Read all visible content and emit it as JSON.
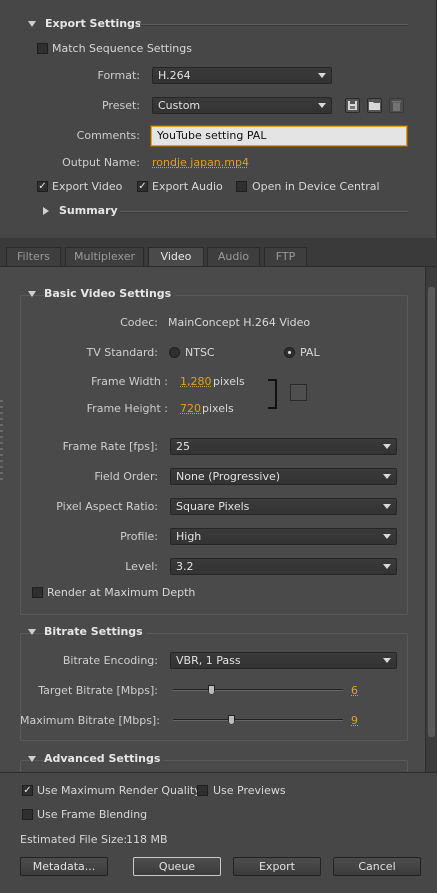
{
  "export_settings": {
    "title": "Export Settings",
    "match_sequence_label": "Match Sequence Settings",
    "match_sequence_checked": false,
    "format_label": "Format:",
    "format_value": "H.264",
    "preset_label": "Preset:",
    "preset_value": "Custom",
    "comments_label": "Comments:",
    "comments_value": "YouTube setting PAL",
    "output_name_label": "Output Name:",
    "output_name_value": "rondje japan.mp4",
    "export_video_label": "Export Video",
    "export_video_checked": true,
    "export_audio_label": "Export Audio",
    "export_audio_checked": true,
    "device_central_label": "Open in Device Central",
    "device_central_checked": false,
    "summary_label": "Summary"
  },
  "tabs": [
    "Filters",
    "Multiplexer",
    "Video",
    "Audio",
    "FTP"
  ],
  "active_tab": "Video",
  "basic_video": {
    "title": "Basic Video Settings",
    "codec_label": "Codec:",
    "codec_value": "MainConcept H.264 Video",
    "tv_standard_label": "TV Standard:",
    "ntsc_label": "NTSC",
    "pal_label": "PAL",
    "tv_standard_selected": "PAL",
    "frame_width_label": "Frame Width :",
    "frame_width_value": "1,280",
    "frame_height_label": "Frame Height :",
    "frame_height_value": "720",
    "pixels_unit": "pixels",
    "frame_rate_label": "Frame Rate [fps]:",
    "frame_rate_value": "25",
    "field_order_label": "Field Order:",
    "field_order_value": "None (Progressive)",
    "pixel_aspect_label": "Pixel Aspect Ratio:",
    "pixel_aspect_value": "Square Pixels",
    "profile_label": "Profile:",
    "profile_value": "High",
    "level_label": "Level:",
    "level_value": "3.2",
    "render_max_depth_label": "Render at Maximum Depth",
    "render_max_depth_checked": false
  },
  "bitrate": {
    "title": "Bitrate Settings",
    "encoding_label": "Bitrate Encoding:",
    "encoding_value": "VBR, 1 Pass",
    "target_label": "Target Bitrate [Mbps]:",
    "target_value": "6",
    "target_fraction": 0.23,
    "max_label": "Maximum Bitrate [Mbps]:",
    "max_value": "9",
    "max_fraction": 0.35
  },
  "advanced": {
    "title": "Advanced Settings"
  },
  "bottom": {
    "max_render_quality_label": "Use Maximum Render Quality",
    "max_render_quality_checked": true,
    "use_previews_label": "Use Previews",
    "use_previews_checked": false,
    "frame_blending_label": "Use Frame Blending",
    "frame_blending_checked": false,
    "file_size_label": "Estimated File Size:",
    "file_size_value": "118 MB",
    "metadata_button": "Metadata...",
    "queue_button": "Queue",
    "export_button": "Export",
    "cancel_button": "Cancel"
  },
  "colors": {
    "background": "#4a4a4a",
    "accent_link": "#e0a020",
    "input_focus_border": "#e0a020"
  },
  "icons": {
    "save_preset": "save-icon",
    "import_preset": "folder-icon",
    "delete_preset": "trash-icon"
  }
}
